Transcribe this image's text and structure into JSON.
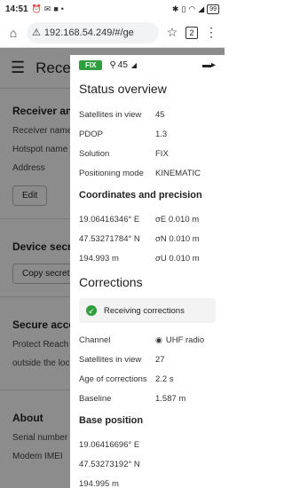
{
  "status_bar": {
    "time": "14:51",
    "battery": "99"
  },
  "browser": {
    "url": "192.168.54.249/#/ge",
    "tab_count": "2"
  },
  "background_page": {
    "title": "Receiv",
    "section1_title": "Receiver and",
    "receiver_name_label": "Receiver name",
    "hotspot_name_label": "Hotspot name",
    "address_label": "Address",
    "edit_label": "Edit",
    "device_secret_title": "Device secre",
    "copy_secret_label": "Copy secret",
    "secure_access_title": "Secure acces",
    "secure_access_text1": "Protect Reach",
    "secure_access_text2": "outside the loc",
    "about_title": "About",
    "serial_label": "Serial number",
    "modem_label": "Modem IMEI"
  },
  "panel": {
    "fix_badge": "FIX",
    "satellites_top": "45",
    "status_title": "Status overview",
    "status_rows": [
      {
        "label": "Satellites in view",
        "value": "45"
      },
      {
        "label": "PDOP",
        "value": "1.3"
      },
      {
        "label": "Solution",
        "value": "FIX"
      },
      {
        "label": "Positioning mode",
        "value": "KINEMATIC"
      }
    ],
    "coords_title": "Coordinates and precision",
    "coords_rows": [
      {
        "coord": "19.06416346° E",
        "precision": "σE 0.010 m"
      },
      {
        "coord": "47.53271784° N",
        "precision": "σN 0.010 m"
      },
      {
        "coord": "194.993 m",
        "precision": "σU 0.010 m"
      }
    ],
    "corrections_title": "Corrections",
    "corrections_status": "Receiving corrections",
    "corrections_rows": [
      {
        "label": "Channel",
        "value": "UHF radio"
      },
      {
        "label": "Satellites in view",
        "value": "27"
      },
      {
        "label": "Age of corrections",
        "value": "2.2 s"
      },
      {
        "label": "Baseline",
        "value": "1.587 m"
      }
    ],
    "base_title": "Base position",
    "base_rows": [
      "19.06416696° E",
      "47.53273192° N",
      "194.995 m"
    ]
  }
}
